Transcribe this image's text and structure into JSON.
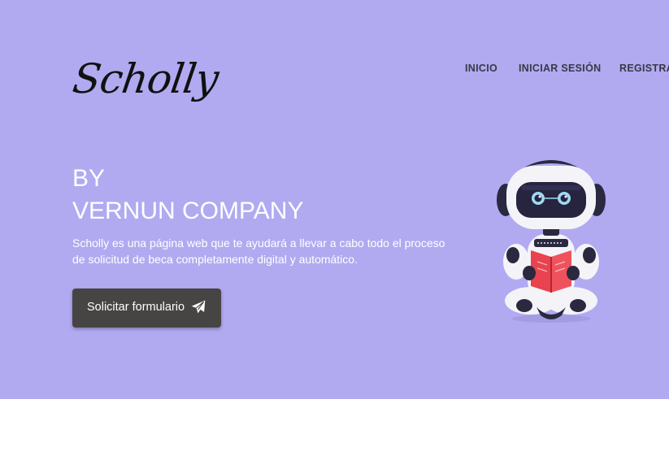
{
  "brand": {
    "logo_text": "Scholly"
  },
  "nav": {
    "items": [
      {
        "label": "INICIO"
      },
      {
        "label": "INICIAR SESIÓN"
      },
      {
        "label": "REGISTRA"
      }
    ]
  },
  "hero": {
    "heading_line1": "BY",
    "heading_line2": "VERNUN COMPANY",
    "description": "Scholly es una página web que te ayudará a llevar a cabo todo el proceso de solicitud de beca completamente digital y automático.",
    "cta_label": "Solicitar formulario",
    "cta_icon": "paper-plane-icon",
    "illustration": "robot-reading-book-icon"
  },
  "colors": {
    "hero_bg": "#b1aaf1",
    "button_bg": "#474444",
    "text_light": "#ffffff",
    "nav_text": "#3a3844",
    "page_bg": "#ffffff"
  }
}
